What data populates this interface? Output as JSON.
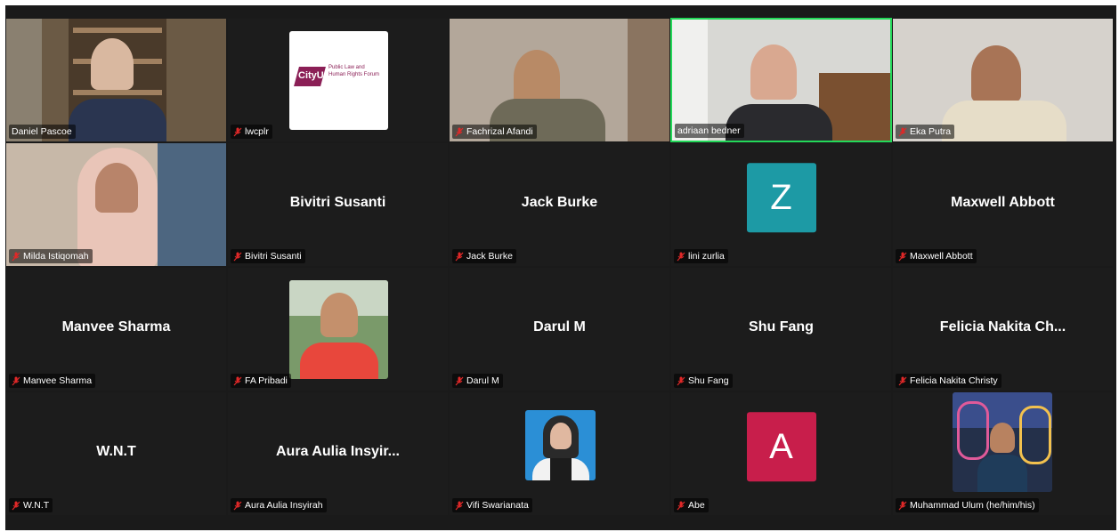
{
  "participants": [
    {
      "label": "Daniel Pascoe"
    },
    {
      "label": "lwcplr",
      "logo_top": "Public Law and",
      "logo_mid": "Human Rights Forum",
      "logo_brand": "CityU"
    },
    {
      "label": "Fachrizal Afandi"
    },
    {
      "label": "adriaan bedner"
    },
    {
      "label": "Eka Putra"
    },
    {
      "label": "Milda Istiqomah"
    },
    {
      "label": "Bivitri Susanti",
      "display": "Bivitri Susanti"
    },
    {
      "label": "Jack Burke",
      "display": "Jack Burke"
    },
    {
      "label": "lini zurlia",
      "initial": "Z"
    },
    {
      "label": "Maxwell Abbott",
      "display": "Maxwell Abbott"
    },
    {
      "label": "Manvee Sharma",
      "display": "Manvee Sharma"
    },
    {
      "label": "FA Pribadi"
    },
    {
      "label": "Darul M",
      "display": "Darul M"
    },
    {
      "label": "Shu Fang",
      "display": "Shu Fang"
    },
    {
      "label": "Felicia Nakita Christy",
      "display": "Felicia Nakita Ch..."
    },
    {
      "label": "W.N.T",
      "display": "W.N.T"
    },
    {
      "label": "Aura Aulia Insyirah",
      "display": "Aura Aulia Insyir..."
    },
    {
      "label": "Vifi Swarianata"
    },
    {
      "label": "Abe",
      "initial": "A"
    },
    {
      "label": "Muhammad Ulum (he/him/his)"
    }
  ],
  "colors": {
    "active_speaker_border": "#23d959",
    "avatar_z": "#1d9aa5",
    "avatar_a": "#c81e4b",
    "muted_icon": "#e02828"
  },
  "icons": {
    "muted": "microphone-muted-icon"
  }
}
